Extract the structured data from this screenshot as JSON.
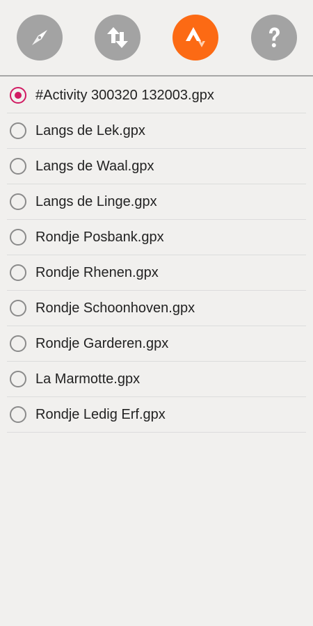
{
  "toolbar": {
    "buttons": [
      {
        "icon": "compass-icon"
      },
      {
        "icon": "sync-arrows-icon"
      },
      {
        "icon": "strava-icon",
        "active": true,
        "color": "#fc6a14"
      },
      {
        "icon": "help-icon",
        "glyph": "?"
      }
    ]
  },
  "colors": {
    "accent": "#d11a62",
    "active_button": "#fc6a14",
    "inactive_button": "#a3a3a3",
    "background": "#f1f0ee"
  },
  "files": [
    {
      "name": "#Activity 300320 132003.gpx",
      "selected": true
    },
    {
      "name": "Langs de Lek.gpx",
      "selected": false
    },
    {
      "name": "Langs de Waal.gpx",
      "selected": false
    },
    {
      "name": "Langs de Linge.gpx",
      "selected": false
    },
    {
      "name": "Rondje Posbank.gpx",
      "selected": false
    },
    {
      "name": "Rondje Rhenen.gpx",
      "selected": false
    },
    {
      "name": "Rondje Schoonhoven.gpx",
      "selected": false
    },
    {
      "name": "Rondje Garderen.gpx",
      "selected": false
    },
    {
      "name": "La Marmotte.gpx",
      "selected": false
    },
    {
      "name": "Rondje Ledig Erf.gpx",
      "selected": false
    }
  ]
}
